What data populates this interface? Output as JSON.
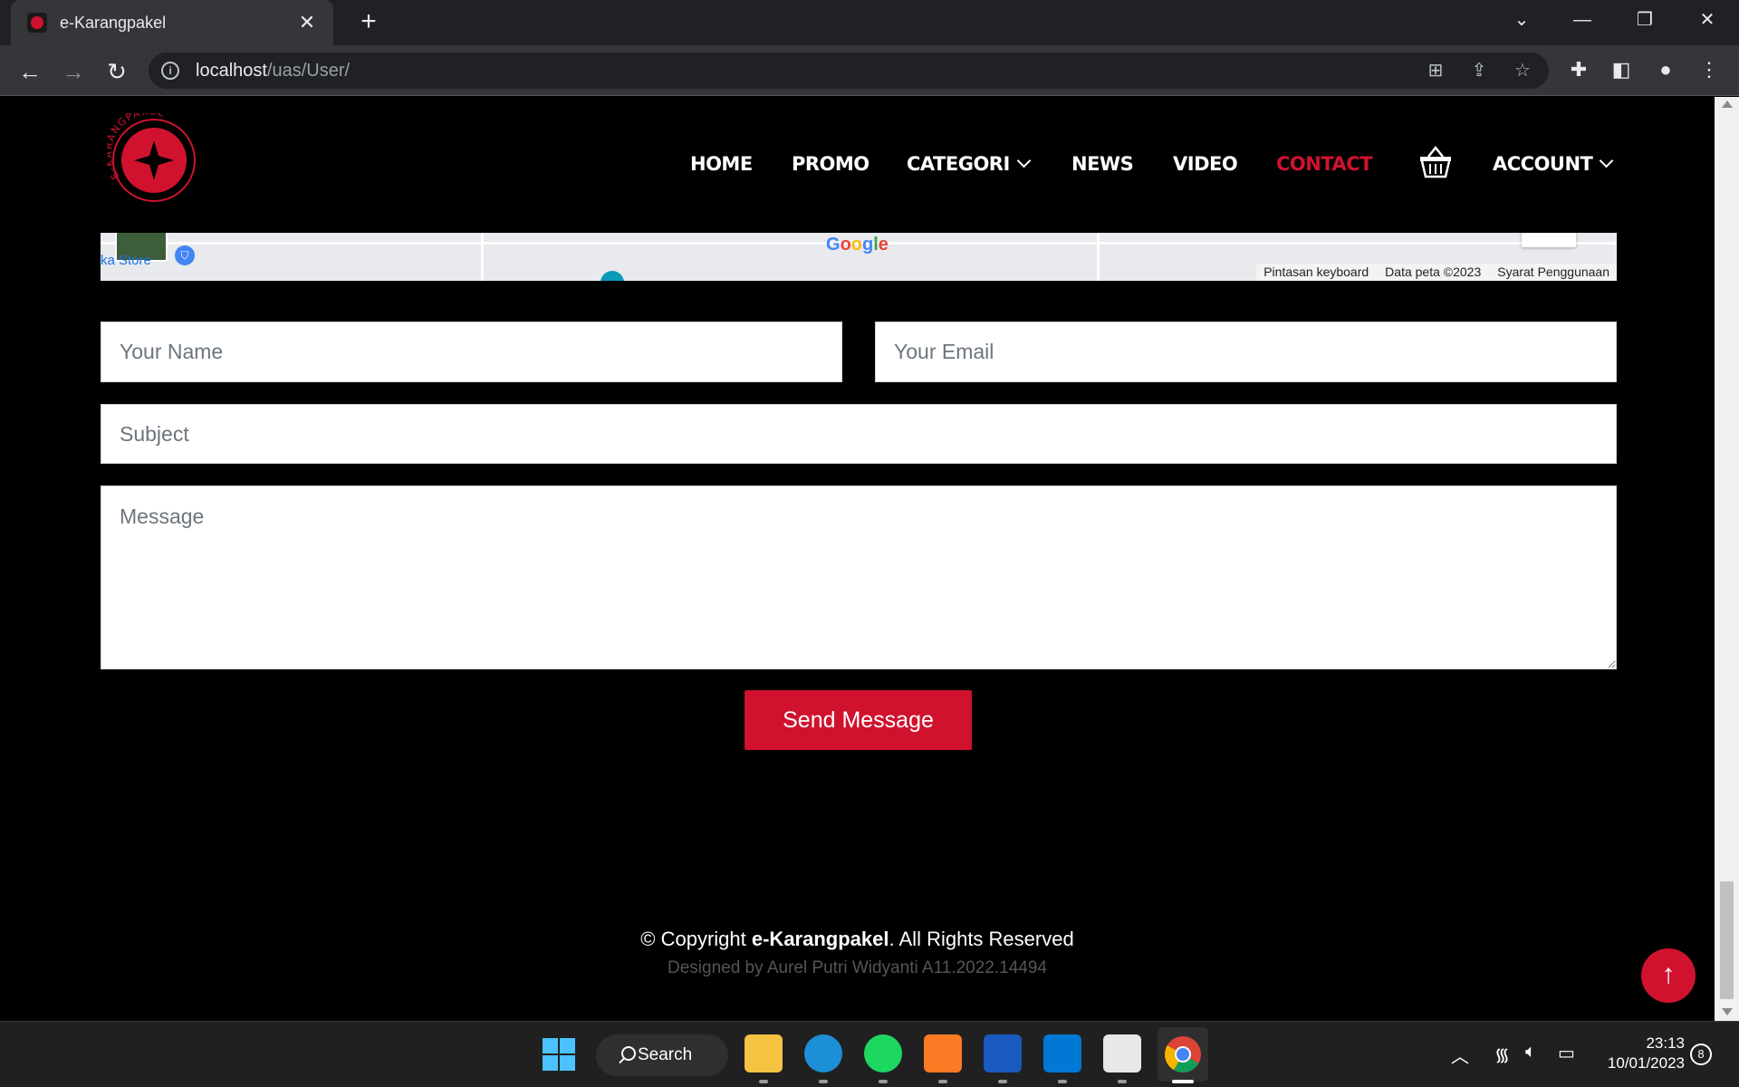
{
  "browser": {
    "tab_title": "e-Karangpakel",
    "url_host": "localhost",
    "url_path": "/uas/User/"
  },
  "nav": {
    "items": [
      {
        "label": "HOME"
      },
      {
        "label": "PROMO"
      },
      {
        "label": "CATEGORI"
      },
      {
        "label": "NEWS"
      },
      {
        "label": "VIDEO"
      },
      {
        "label": "CONTACT"
      },
      {
        "label": "ACCOUNT"
      }
    ],
    "logo_text": "E-KARANGPAKEL"
  },
  "map": {
    "google_label": "Google",
    "store_label": "ka Store",
    "attribution": [
      "Pintasan keyboard",
      "Data peta ©2023",
      "Syarat Penggunaan"
    ]
  },
  "form": {
    "name_placeholder": "Your Name",
    "email_placeholder": "Your Email",
    "subject_placeholder": "Subject",
    "message_placeholder": "Message",
    "send_label": "Send Message"
  },
  "footer": {
    "copyright_prefix": "© Copyright ",
    "brand": "e-Karangpakel",
    "copyright_suffix": ". All Rights Reserved",
    "designed_by": "Designed by Aurel Putri Widyanti A11.2022.14494"
  },
  "taskbar": {
    "search_label": "Search",
    "time": "23:13",
    "date": "10/01/2023",
    "notification_count": "8"
  },
  "colors": {
    "accent": "#d0122f",
    "background": "#000000"
  }
}
